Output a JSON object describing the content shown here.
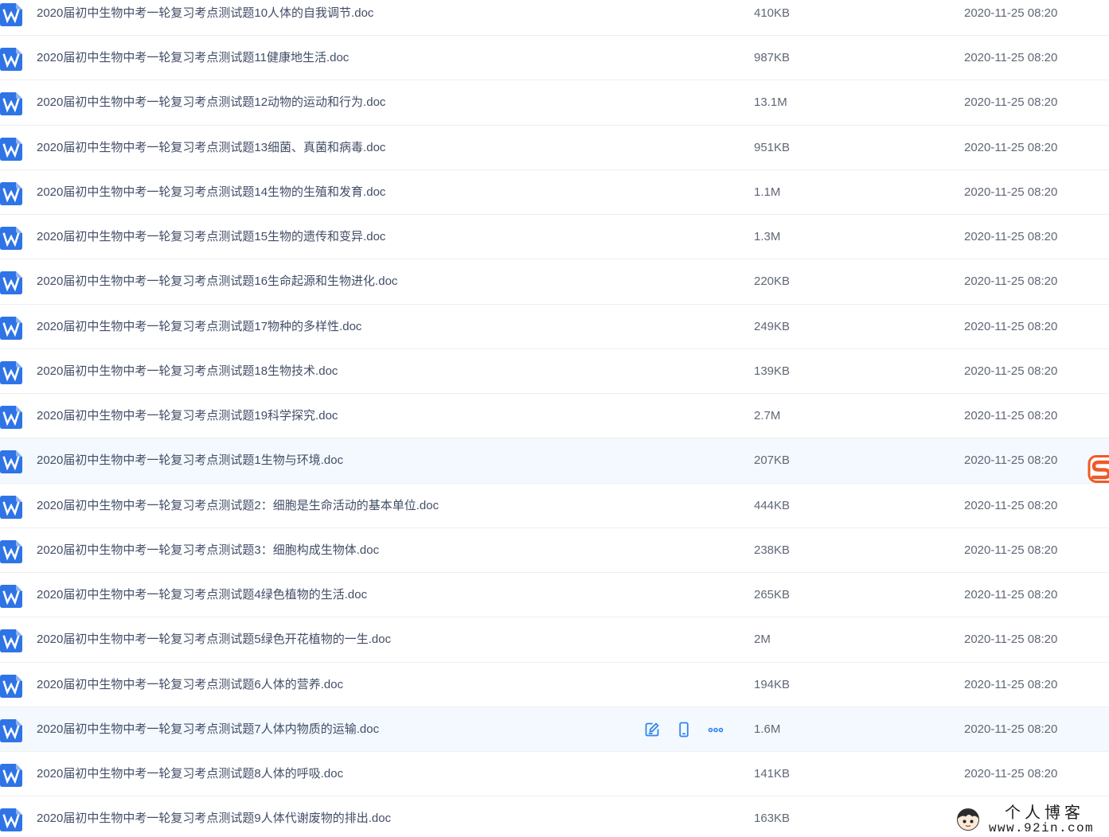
{
  "colors": {
    "word_icon": "#2f74e6",
    "action_icon": "#2f86f0",
    "row_highlight": "#f3f9fe",
    "file_name_text": "#424e67",
    "meta_text": "#5f6776",
    "sogou_orange": "#ef5a27"
  },
  "row_action_icons": [
    "edit-icon",
    "mobile-icon",
    "more-icon"
  ],
  "files": [
    {
      "icon": "word-doc-icon",
      "name": "2020届初中生物中考一轮复习考点测试题10人体的自我调节.doc",
      "size": "410KB",
      "date": "2020-11-25 08:20"
    },
    {
      "icon": "word-doc-icon",
      "name": "2020届初中生物中考一轮复习考点测试题11健康地生活.doc",
      "size": "987KB",
      "date": "2020-11-25 08:20"
    },
    {
      "icon": "word-doc-icon",
      "name": "2020届初中生物中考一轮复习考点测试题12动物的运动和行为.doc",
      "size": "13.1M",
      "date": "2020-11-25 08:20"
    },
    {
      "icon": "word-doc-icon",
      "name": "2020届初中生物中考一轮复习考点测试题13细菌、真菌和病毒.doc",
      "size": "951KB",
      "date": "2020-11-25 08:20"
    },
    {
      "icon": "word-doc-icon",
      "name": "2020届初中生物中考一轮复习考点测试题14生物的生殖和发育.doc",
      "size": "1.1M",
      "date": "2020-11-25 08:20"
    },
    {
      "icon": "word-doc-icon",
      "name": "2020届初中生物中考一轮复习考点测试题15生物的遗传和变异.doc",
      "size": "1.3M",
      "date": "2020-11-25 08:20"
    },
    {
      "icon": "word-doc-icon",
      "name": "2020届初中生物中考一轮复习考点测试题16生命起源和生物进化.doc",
      "size": "220KB",
      "date": "2020-11-25 08:20"
    },
    {
      "icon": "word-doc-icon",
      "name": "2020届初中生物中考一轮复习考点测试题17物种的多样性.doc",
      "size": "249KB",
      "date": "2020-11-25 08:20"
    },
    {
      "icon": "word-doc-icon",
      "name": "2020届初中生物中考一轮复习考点测试题18生物技术.doc",
      "size": "139KB",
      "date": "2020-11-25 08:20"
    },
    {
      "icon": "word-doc-icon",
      "name": "2020届初中生物中考一轮复习考点测试题19科学探究.doc",
      "size": "2.7M",
      "date": "2020-11-25 08:20"
    },
    {
      "icon": "word-doc-icon",
      "name": "2020届初中生物中考一轮复习考点测试题1生物与环境.doc",
      "size": "207KB",
      "date": "2020-11-25 08:20",
      "highlighted": true
    },
    {
      "icon": "word-doc-icon",
      "name": "2020届初中生物中考一轮复习考点测试题2：细胞是生命活动的基本单位.doc",
      "size": "444KB",
      "date": "2020-11-25 08:20"
    },
    {
      "icon": "word-doc-icon",
      "name": "2020届初中生物中考一轮复习考点测试题3：细胞构成生物体.doc",
      "size": "238KB",
      "date": "2020-11-25 08:20"
    },
    {
      "icon": "word-doc-icon",
      "name": "2020届初中生物中考一轮复习考点测试题4绿色植物的生活.doc",
      "size": "265KB",
      "date": "2020-11-25 08:20"
    },
    {
      "icon": "word-doc-icon",
      "name": "2020届初中生物中考一轮复习考点测试题5绿色开花植物的一生.doc",
      "size": "2M",
      "date": "2020-11-25 08:20"
    },
    {
      "icon": "word-doc-icon",
      "name": "2020届初中生物中考一轮复习考点测试题6人体的营养.doc",
      "size": "194KB",
      "date": "2020-11-25 08:20"
    },
    {
      "icon": "word-doc-icon",
      "name": "2020届初中生物中考一轮复习考点测试题7人体内物质的运输.doc",
      "size": "1.6M",
      "date": "2020-11-25 08:20",
      "highlighted": true,
      "show_actions": true
    },
    {
      "icon": "word-doc-icon",
      "name": "2020届初中生物中考一轮复习考点测试题8人体的呼吸.doc",
      "size": "141KB",
      "date": "2020-11-25 08:20"
    },
    {
      "icon": "word-doc-icon",
      "name": "2020届初中生物中考一轮复习考点测试题9人体代谢废物的排出.doc",
      "size": "163KB"
    }
  ],
  "floating_icons": [
    "sogou-ime-icon"
  ],
  "watermark": {
    "title": "个人博客",
    "url": "www.92in.com"
  }
}
